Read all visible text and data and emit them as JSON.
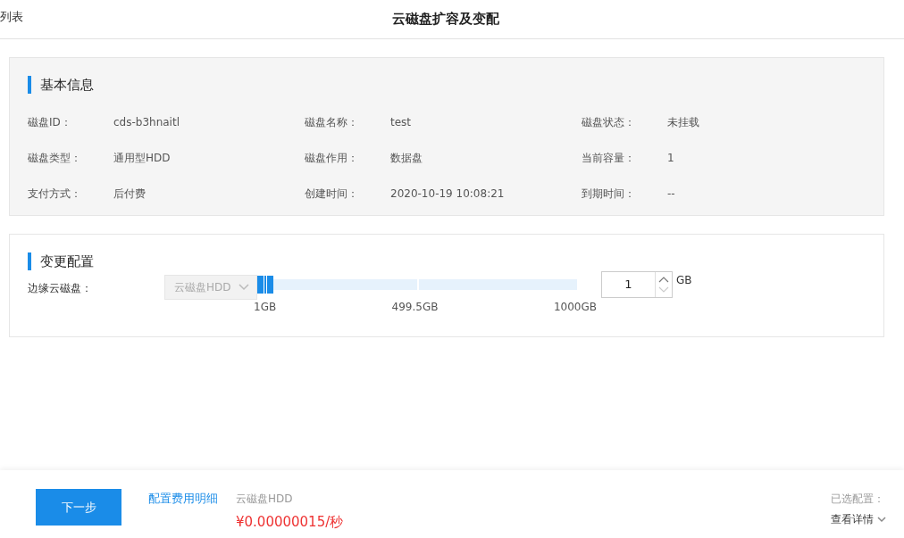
{
  "header": {
    "back_link": "列表",
    "title": "云磁盘扩容及变配"
  },
  "basic_info": {
    "title": "基本信息",
    "fields": [
      {
        "label": "磁盘ID：",
        "value": "cds-b3hnaitl"
      },
      {
        "label": "磁盘名称：",
        "value": "test"
      },
      {
        "label": "磁盘状态：",
        "value": "未挂载"
      },
      {
        "label": "磁盘类型：",
        "value": "通用型HDD"
      },
      {
        "label": "磁盘作用：",
        "value": "数据盘"
      },
      {
        "label": "当前容量：",
        "value": "1"
      },
      {
        "label": "支付方式：",
        "value": "后付费"
      },
      {
        "label": "创建时间：",
        "value": "2020-10-19 10:08:21"
      },
      {
        "label": "到期时间：",
        "value": "--"
      }
    ]
  },
  "config": {
    "title": "变更配置",
    "label": "边缘云磁盘：",
    "disk_type": {
      "value": "云磁盘HDD",
      "disabled": true
    },
    "slider": {
      "level": 0,
      "marks": [
        "1GB",
        "499.5GB",
        "1000GB"
      ]
    },
    "size_input": {
      "value": "1"
    },
    "unit": "GB"
  },
  "footer": {
    "next_button": "下一步",
    "fee_link": "配置费用明细",
    "product": "云磁盘HDD",
    "price": "¥0.00000015/秒",
    "selected_label": "已选配置：",
    "details_link": "查看详情"
  }
}
